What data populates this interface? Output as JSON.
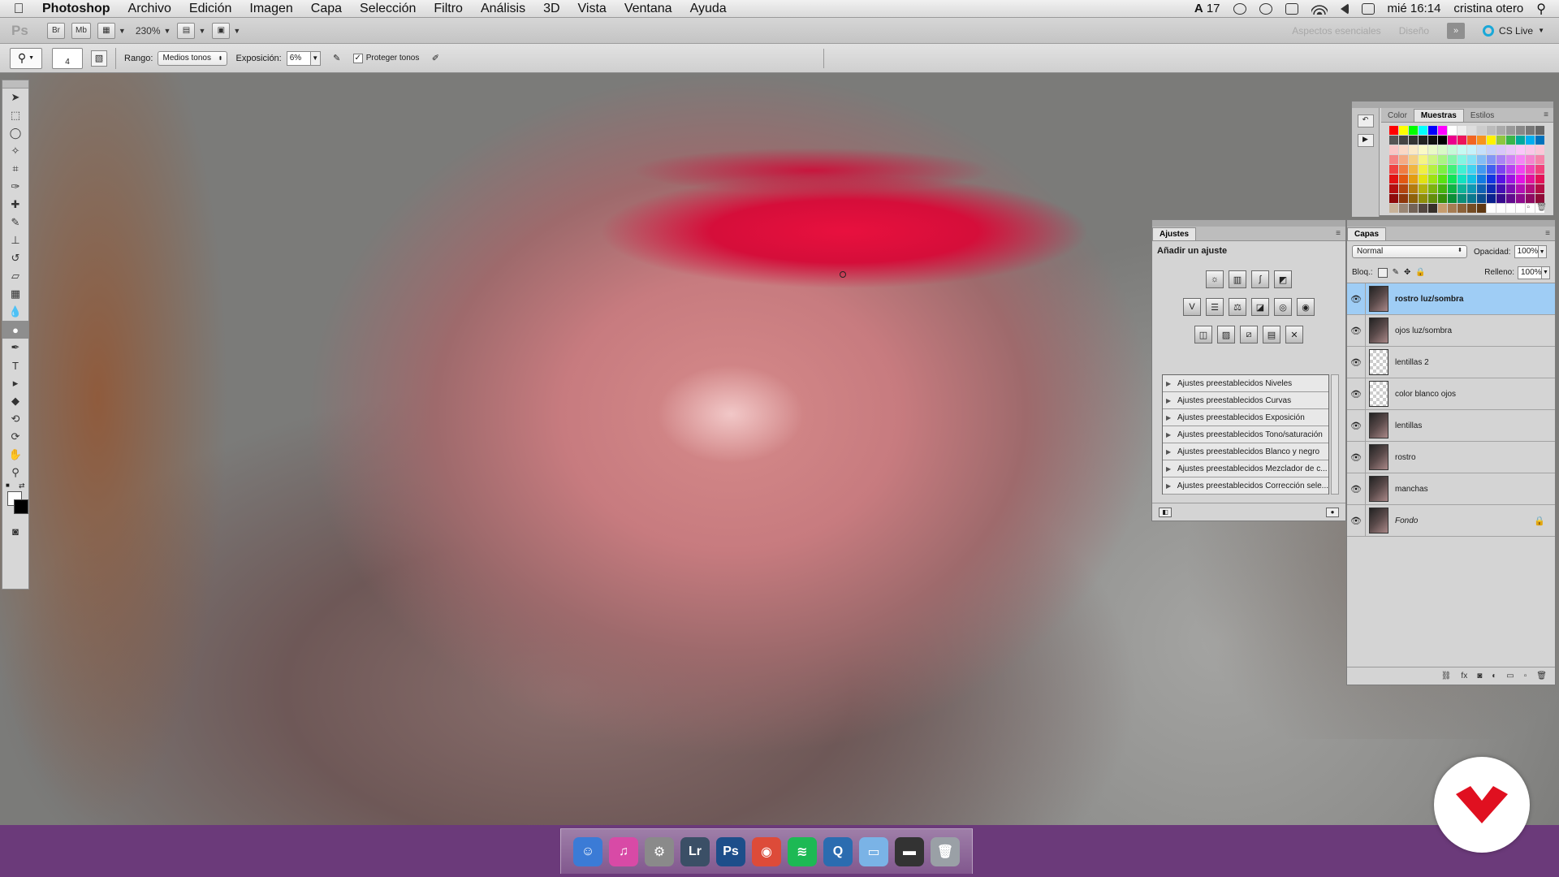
{
  "menubar": {
    "app": "Photoshop",
    "items": [
      "Archivo",
      "Edición",
      "Imagen",
      "Capa",
      "Selección",
      "Filtro",
      "Análisis",
      "3D",
      "Vista",
      "Ventana",
      "Ayuda"
    ],
    "status": {
      "adobe_count": "17",
      "datetime": "mié 16:14",
      "user": "cristina otero"
    }
  },
  "appbar": {
    "ps": "Ps",
    "br": "Br",
    "mb": "Mb",
    "zoom": "230%",
    "workspace_essentials": "Aspectos esenciales",
    "workspace_design": "Diseño",
    "overflow": "»",
    "cs_live": "CS Live"
  },
  "options": {
    "brush_size": "4",
    "range_label": "Rango:",
    "range_value": "Medios tonos",
    "exposure_label": "Exposición:",
    "exposure_value": "6%",
    "protect_label": "Proteger tonos",
    "protect_checked": true
  },
  "swatches_panel": {
    "tabs": [
      "Color",
      "Muestras",
      "Estilos"
    ],
    "active_tab": "Muestras"
  },
  "adjustments_panel": {
    "tab": "Ajustes",
    "title": "Añadir un ajuste",
    "presets": [
      "Ajustes preestablecidos Niveles",
      "Ajustes preestablecidos Curvas",
      "Ajustes preestablecidos Exposición",
      "Ajustes preestablecidos Tono/saturación",
      "Ajustes preestablecidos Blanco y negro",
      "Ajustes preestablecidos Mezclador de c...",
      "Ajustes preestablecidos Corrección sele..."
    ]
  },
  "layers_panel": {
    "tab": "Capas",
    "blend_mode": "Normal",
    "opacity_label": "Opacidad:",
    "opacity_value": "100%",
    "lock_label": "Bloq.:",
    "fill_label": "Relleno:",
    "fill_value": "100%",
    "layers": [
      {
        "name": "rostro luz/sombra",
        "active": true,
        "thumb": "photo"
      },
      {
        "name": "ojos luz/sombra",
        "active": false,
        "thumb": "photo"
      },
      {
        "name": "lentillas 2",
        "active": false,
        "thumb": "transparent"
      },
      {
        "name": "color blanco ojos",
        "active": false,
        "thumb": "transparent"
      },
      {
        "name": "lentillas",
        "active": false,
        "thumb": "photo"
      },
      {
        "name": "rostro",
        "active": false,
        "thumb": "photo"
      },
      {
        "name": "manchas",
        "active": false,
        "thumb": "photo"
      },
      {
        "name": "Fondo",
        "active": false,
        "thumb": "photo",
        "locked": true
      }
    ]
  },
  "dock": {
    "apps": [
      {
        "name": "finder",
        "glyph": "☺",
        "color": "#3b7bd6"
      },
      {
        "name": "itunes",
        "glyph": "♫",
        "color": "#d84aa6"
      },
      {
        "name": "system-preferences",
        "glyph": "⚙",
        "color": "#8a8a8a"
      },
      {
        "name": "lightroom",
        "glyph": "Lr",
        "color": "#3b4f66"
      },
      {
        "name": "photoshop",
        "glyph": "Ps",
        "color": "#1d4e8a"
      },
      {
        "name": "chrome",
        "glyph": "◉",
        "color": "#dd4b39"
      },
      {
        "name": "spotify",
        "glyph": "≋",
        "color": "#1db954"
      },
      {
        "name": "quicktime",
        "glyph": "Q",
        "color": "#2b6cb0"
      },
      {
        "name": "folder",
        "glyph": "▭",
        "color": "#7ab3e6"
      },
      {
        "name": "app-window",
        "glyph": "▬",
        "color": "#333333"
      },
      {
        "name": "trash",
        "glyph": "🗑",
        "color": "#9aa0a6"
      }
    ]
  },
  "colors": {
    "selection": "#9fcdf5",
    "lips": "#e8103e",
    "dock": "#6b3a7a",
    "badge_logo": "#e01020"
  }
}
